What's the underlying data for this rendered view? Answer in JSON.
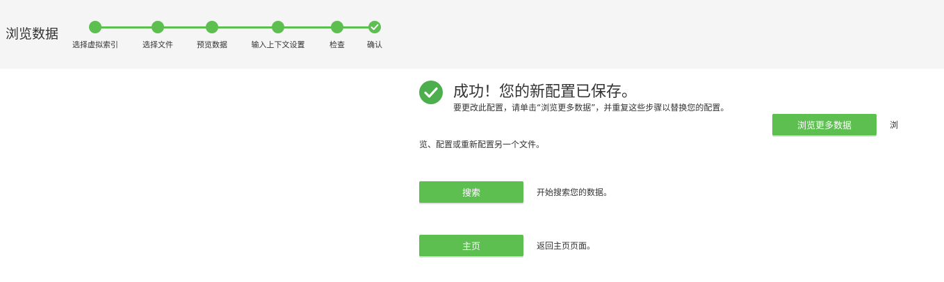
{
  "colors": {
    "accent": "#5cbf4f",
    "header_bg": "#f5f5f5",
    "success_icon": "#4cae4c"
  },
  "header": {
    "title": "浏览数据"
  },
  "wizard": {
    "steps": [
      {
        "label": "选择虚拟索引",
        "state": "complete"
      },
      {
        "label": "选择文件",
        "state": "complete"
      },
      {
        "label": "预览数据",
        "state": "complete"
      },
      {
        "label": "输入上下文设置",
        "state": "complete"
      },
      {
        "label": "检查",
        "state": "complete"
      },
      {
        "label": "确认",
        "state": "current",
        "icon": "check-icon"
      }
    ]
  },
  "success": {
    "icon": "check-circle-icon",
    "title": "成功！您的新配置已保存。",
    "description": "要更改此配置，请单击“浏览更多数据”，并重复这些步骤以替换您的配置。"
  },
  "actions": {
    "browse_more": {
      "button_label": "浏览更多数据",
      "text_line1": "浏",
      "text_line2": "览、配置或重新配置另一个文件。"
    },
    "search": {
      "button_label": "搜索",
      "text": "开始搜索您的数据。"
    },
    "home": {
      "button_label": "主页",
      "text": "返回主页页面。"
    }
  }
}
